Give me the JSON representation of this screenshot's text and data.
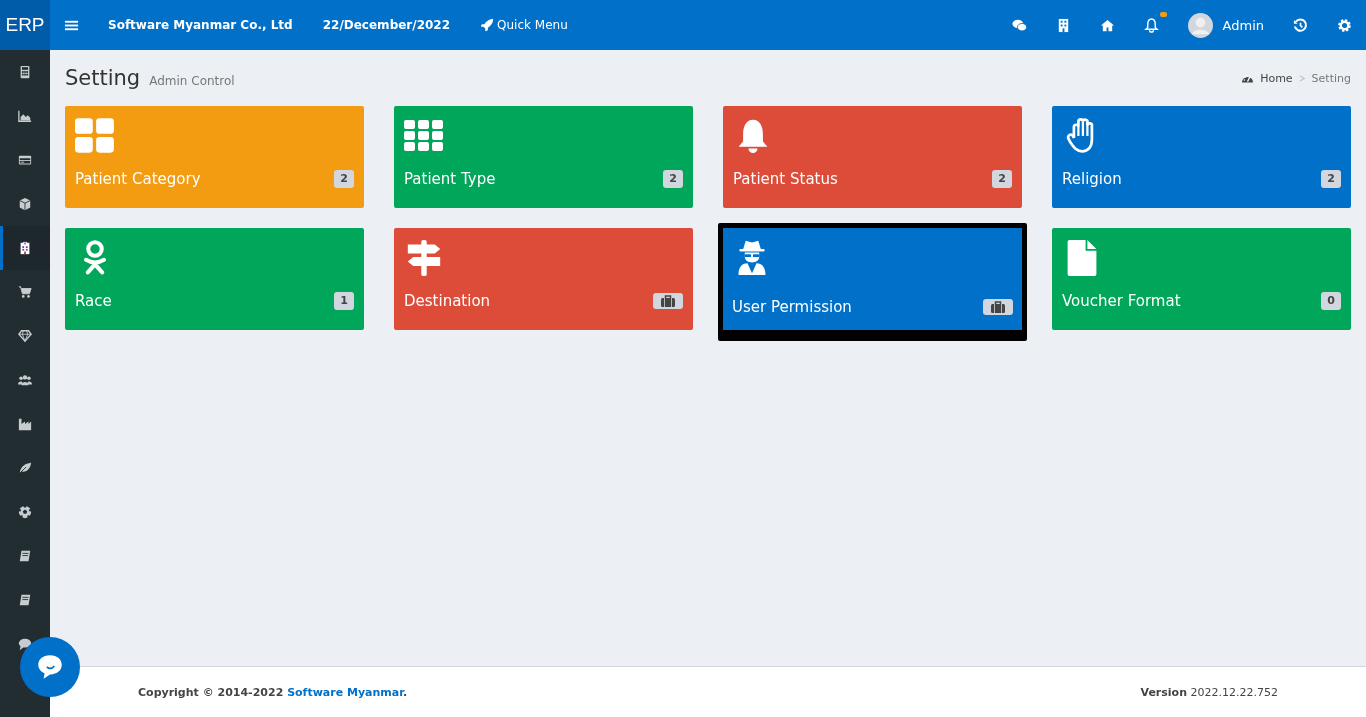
{
  "header": {
    "brand": "ERP",
    "company": "Software Myanmar Co., Ltd",
    "date": "22/December/2022",
    "quick_menu": "Quick Menu",
    "notification_dot": true,
    "user": "Admin"
  },
  "sidebar": {
    "items": [
      {
        "kind": "calculator",
        "selected": false
      },
      {
        "kind": "chart",
        "selected": false
      },
      {
        "kind": "card",
        "selected": false
      },
      {
        "kind": "cube",
        "selected": false
      },
      {
        "kind": "hospital",
        "selected": true
      },
      {
        "kind": "cart",
        "selected": false
      },
      {
        "kind": "diamond",
        "selected": false
      },
      {
        "kind": "users",
        "selected": false
      },
      {
        "kind": "industry",
        "selected": false
      },
      {
        "kind": "leaf",
        "selected": false
      },
      {
        "kind": "ball",
        "selected": false
      },
      {
        "kind": "book",
        "selected": false
      },
      {
        "kind": "book",
        "selected": false
      },
      {
        "kind": "comment",
        "selected": false
      }
    ]
  },
  "page": {
    "title": "Setting",
    "subtitle": "Admin Control",
    "breadcrumb": [
      "Home",
      "Setting"
    ]
  },
  "tiles": [
    {
      "label": "Patient Category",
      "kind": "grid4",
      "color": "#f39c12",
      "count": "2",
      "selected": false
    },
    {
      "label": "Patient Type",
      "kind": "grid9",
      "color": "#00a65a",
      "count": "2",
      "selected": false
    },
    {
      "label": "Patient Status",
      "kind": "bell",
      "color": "#dd4b39",
      "count": "2",
      "selected": false
    },
    {
      "label": "Religion",
      "kind": "hand",
      "color": "#0070c9",
      "count": "2",
      "selected": false
    },
    {
      "label": "Race",
      "kind": "person",
      "color": "#00a65a",
      "count": "1",
      "selected": false
    },
    {
      "label": "Destination",
      "kind": "signpost",
      "color": "#dd4b39",
      "selected": false
    },
    {
      "label": "User Permission",
      "kind": "spy",
      "color": "#0070c9",
      "selected": true
    },
    {
      "label": "Voucher Format",
      "kind": "file",
      "color": "#00a65a",
      "count": "0",
      "selected": false
    }
  ],
  "footer": {
    "copyright": "Copyright © 2014-2022 ",
    "company_link": "Software Myanmar",
    "copyright_end": ".",
    "version": "**Version** 2022.12.22.752"
  }
}
